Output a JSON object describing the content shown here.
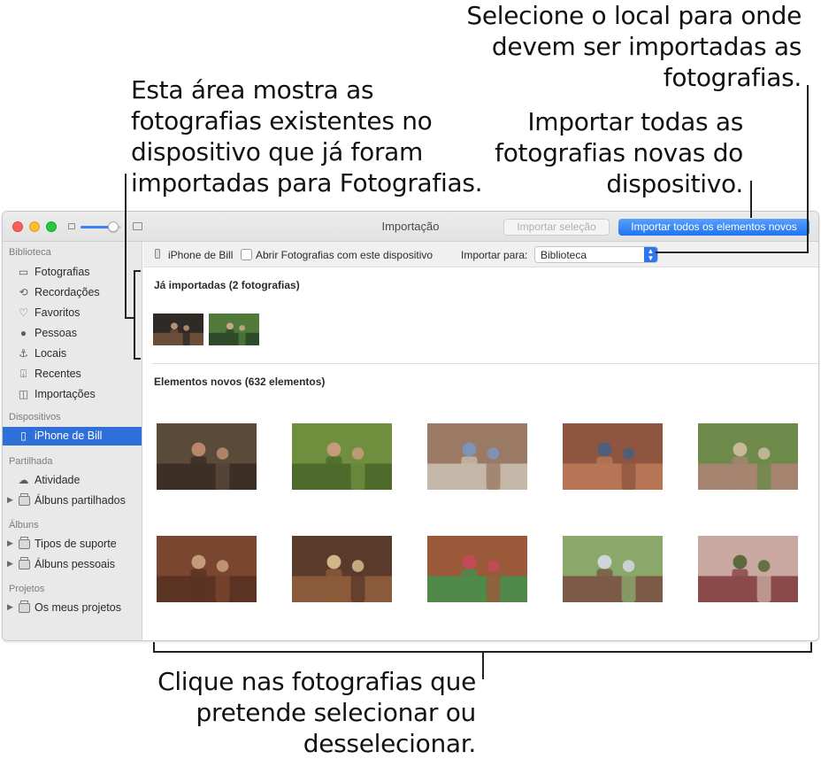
{
  "callouts": {
    "destination": [
      "Selecione o local para onde",
      "devem ser importadas as",
      "fotografias."
    ],
    "import_all": [
      "Importar todas as",
      "fotografias novas do",
      "dispositivo."
    ],
    "existing_area": [
      "Esta área mostra as",
      "fotografias existentes no",
      "dispositivo que já foram",
      "importadas para Fotografias."
    ],
    "click_photos": [
      "Clique nas fotografias que",
      "pretende selecionar ou",
      "desselecionar."
    ]
  },
  "window": {
    "title": "Importação",
    "import_selection_label": "Importar seleção",
    "import_all_label": "Importar todos os elementos novos"
  },
  "sidebar": {
    "sections": [
      {
        "title": "Biblioteca",
        "items": [
          {
            "label": "Fotografias",
            "icon": "photos-icon"
          },
          {
            "label": "Recordações",
            "icon": "memories-icon"
          },
          {
            "label": "Favoritos",
            "icon": "heart-icon"
          },
          {
            "label": "Pessoas",
            "icon": "person-icon"
          },
          {
            "label": "Locais",
            "icon": "pin-icon"
          },
          {
            "label": "Recentes",
            "icon": "recent-icon"
          },
          {
            "label": "Importações",
            "icon": "imports-icon"
          }
        ]
      },
      {
        "title": "Dispositivos",
        "items": [
          {
            "label": "iPhone de Bill",
            "icon": "iphone-icon",
            "selected": true
          }
        ]
      },
      {
        "title": "Partilhada",
        "items": [
          {
            "label": "Atividade",
            "icon": "cloud-icon"
          },
          {
            "label": "Álbuns partilhados",
            "icon": "album-stack-icon"
          }
        ]
      },
      {
        "title": "Álbuns",
        "items": [
          {
            "label": "Tipos de suporte",
            "icon": "album-stack-icon"
          },
          {
            "label": "Álbuns pessoais",
            "icon": "album-stack-icon"
          }
        ]
      },
      {
        "title": "Projetos",
        "items": [
          {
            "label": "Os meus projetos",
            "icon": "album-stack-icon"
          }
        ]
      }
    ]
  },
  "toolbar": {
    "device_name": "iPhone de Bill",
    "open_photos_label": "Abrir Fotografias com este dispositivo",
    "open_photos_checked": false,
    "import_to_label": "Importar para:",
    "import_to_value": "Biblioteca"
  },
  "imported_section_title": "Já importadas (2 fotografias)",
  "new_section_title": "Elementos novos (632 elementos)",
  "colors": {
    "accent": "#1f74f0",
    "selected_sidebar": "#2e6fd9",
    "sidebar_bg": "#e9e9e9"
  }
}
